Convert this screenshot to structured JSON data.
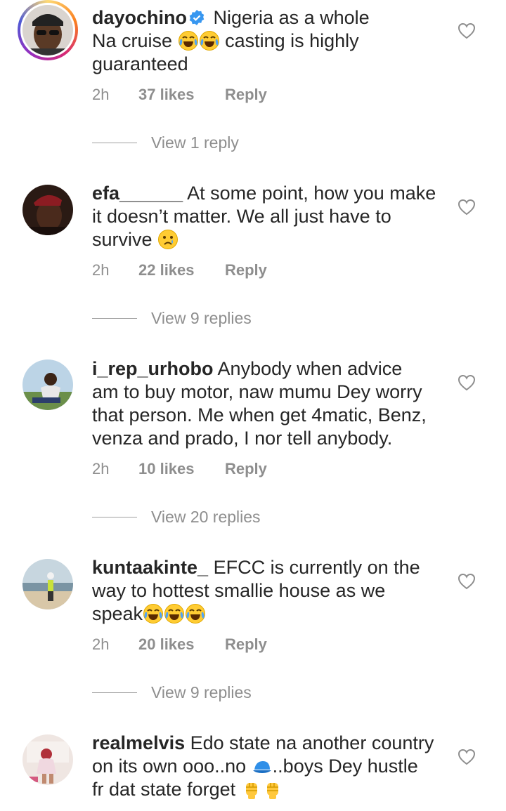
{
  "comments": [
    {
      "username": "dayochino",
      "verified": true,
      "lines": [
        "Nigeria as a whole",
        "Na cruise",
        "casting is highly",
        "guaranteed"
      ],
      "time": "2h",
      "likes": "37 likes",
      "reply_label": "Reply",
      "view_replies": "View 1 reply"
    },
    {
      "username": "efa______",
      "lines": [
        "At some point, how you make",
        "it doesn’t matter. We all just have to",
        "survive"
      ],
      "time": "2h",
      "likes": "22 likes",
      "reply_label": "Reply",
      "view_replies": "View 9 replies"
    },
    {
      "username": "i_rep_urhobo",
      "lines": [
        "Anybody when advice",
        "am to buy motor, naw mumu Dey worry",
        "that person. Me when get 4matic, Benz,",
        "venza and prado, I nor tell anybody."
      ],
      "time": "2h",
      "likes": "10 likes",
      "reply_label": "Reply",
      "view_replies": "View 20 replies"
    },
    {
      "username": "kuntaakinte_",
      "lines": [
        "EFCC is currently on the",
        "way to hottest smallie house as we",
        "speak"
      ],
      "time": "2h",
      "likes": "20 likes",
      "reply_label": "Reply",
      "view_replies": "View 9 replies"
    },
    {
      "username": "realmelvis",
      "lines": [
        "Edo state na another country",
        "on its own ooo..no",
        "..boys Dey hustle",
        "fr dat state forget"
      ]
    }
  ],
  "icons": {
    "like": "heart-outline-icon",
    "verified": "verified-badge-icon",
    "emoji_laugh": "face-with-tears-of-joy-emoji",
    "emoji_cry": "crying-face-emoji",
    "emoji_cap": "blue-cap-emoji",
    "emoji_fist": "raised-fist-emoji"
  },
  "colors": {
    "text": "#262626",
    "secondary": "#8e8e8e",
    "verified": "#3897f0"
  }
}
